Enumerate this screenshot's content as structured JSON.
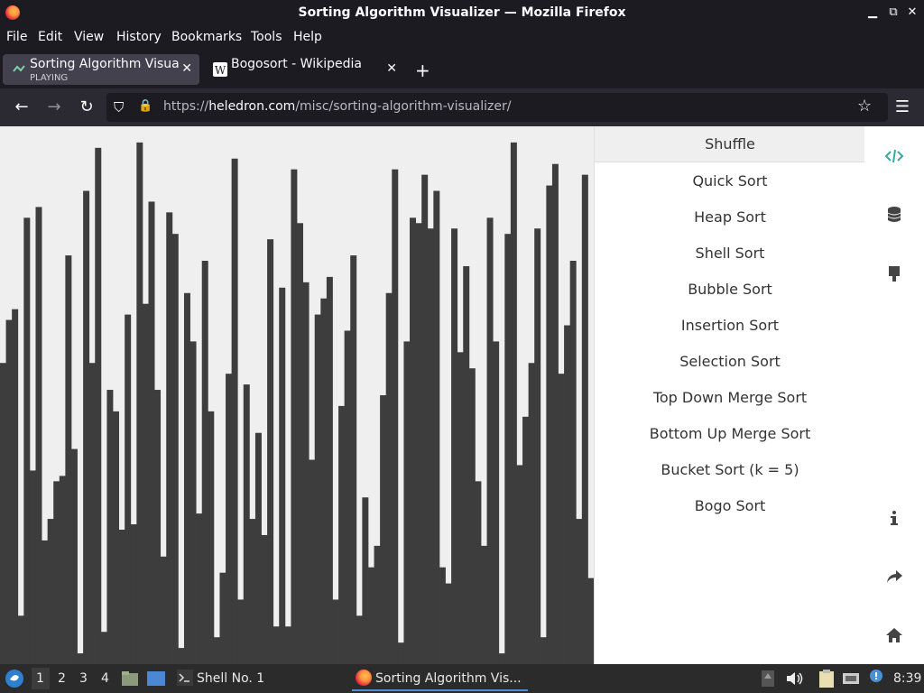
{
  "window": {
    "title": "Sorting Algorithm Visualizer — Mozilla Firefox",
    "controls": {
      "minimize": "▁",
      "restore": "⧉",
      "close": "✕"
    }
  },
  "menubar": [
    "File",
    "Edit",
    "View",
    "History",
    "Bookmarks",
    "Tools",
    "Help"
  ],
  "tabs": [
    {
      "title": "Sorting Algorithm Visualizer",
      "subtitle": "PLAYING",
      "active": true,
      "icon": "visualizer-favicon"
    },
    {
      "title": "Bogosort - Wikipedia",
      "subtitle": "",
      "active": false,
      "icon": "wikipedia-icon"
    }
  ],
  "new_tab_label": "+",
  "nav": {
    "back": "←",
    "forward": "→",
    "reload": "↻",
    "shield": "⛉",
    "lock": "🔒",
    "url_prefix": "https://",
    "url_host": "heledron.com",
    "url_path": "/misc/sorting-algorithm-visualizer/",
    "star": "☆",
    "menu": "☰"
  },
  "algorithms": [
    "Shuffle",
    "Quick Sort",
    "Heap Sort",
    "Shell Sort",
    "Bubble Sort",
    "Insertion Sort",
    "Selection Sort",
    "Top Down Merge Sort",
    "Bottom Up Merge Sort",
    "Bucket Sort (k = 5)",
    "Bogo Sort"
  ],
  "selected_algorithm": "Shuffle",
  "sidebar_icons": {
    "top": [
      "code-icon",
      "database-icon",
      "paintbrush-icon"
    ],
    "bottom": [
      "info-icon",
      "share-icon",
      "home-icon"
    ]
  },
  "visualizer": {
    "bar_color": "#3d3d3d",
    "background": "#efefef",
    "values": [
      0.56,
      0.64,
      0.66,
      0.09,
      0.83,
      0.36,
      0.85,
      0.23,
      0.27,
      0.34,
      0.35,
      0.76,
      0.4,
      0.02,
      0.88,
      0.56,
      0.96,
      0.06,
      0.51,
      0.47,
      0.25,
      0.65,
      0.26,
      0.97,
      0.67,
      0.86,
      0.51,
      0.2,
      0.84,
      0.8,
      0.03,
      0.69,
      0.6,
      0.28,
      0.75,
      0.47,
      0.05,
      0.17,
      0.54,
      0.94,
      0.12,
      0.52,
      0.27,
      0.43,
      0.24,
      0.79,
      0.07,
      0.7,
      0.07,
      0.92,
      0.82,
      0.71,
      0.38,
      0.65,
      0.68,
      0.72,
      0.12,
      0.48,
      0.62,
      0.76,
      0.09,
      0.31,
      0.18,
      0.22,
      0.5,
      0.69,
      0.92,
      0.04,
      0.6,
      0.83,
      0.82,
      0.91,
      0.81,
      0.88,
      0.18,
      0.15,
      0.81,
      0.58,
      0.74,
      0.55,
      0.34,
      0.22,
      0.83,
      0.6,
      0.02,
      0.8,
      0.97,
      0.37,
      0.46,
      0.56,
      0.81,
      0.05,
      0.89,
      0.93,
      0.54,
      0.63,
      0.75,
      0.27,
      0.91,
      0.16
    ]
  },
  "taskbar": {
    "start_icon": "start-menu-icon",
    "workspaces": [
      "1",
      "2",
      "3",
      "4"
    ],
    "windows": [
      {
        "label": "Shell No. 1",
        "icon": "terminal-icon"
      },
      {
        "label": "Sorting Algorithm Vis...",
        "icon": "firefox-icon"
      }
    ],
    "clock": "8:39"
  }
}
